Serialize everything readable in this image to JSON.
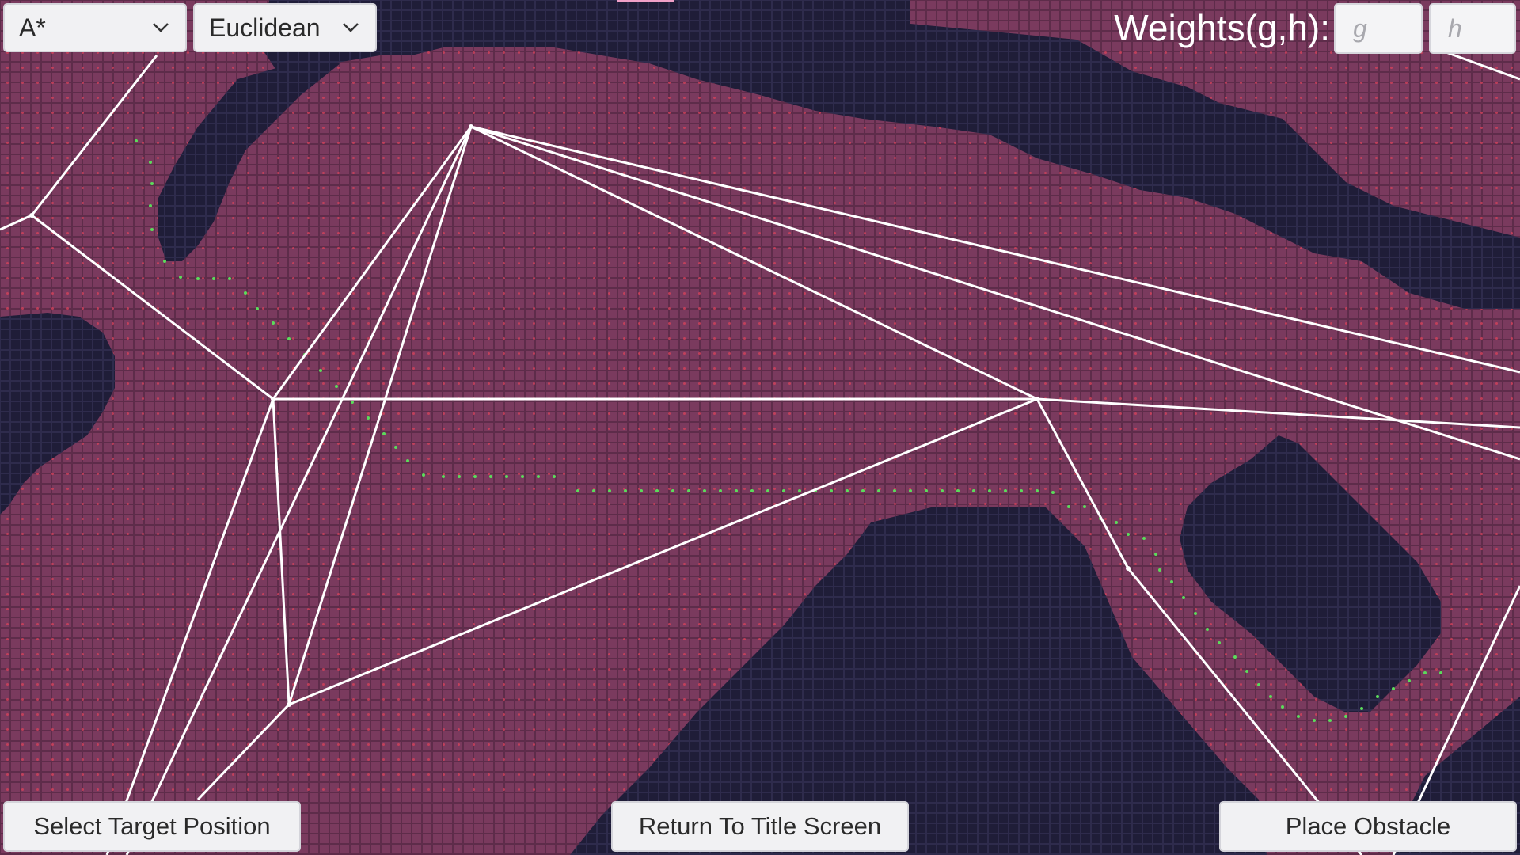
{
  "toolbar": {
    "algorithm": {
      "selected": "A*",
      "icon": "chevron-down-icon"
    },
    "heuristic": {
      "selected": "Euclidean",
      "icon": "chevron-down-icon"
    },
    "weights_label": "Weights(g,h):",
    "g_placeholder": "g",
    "h_placeholder": "h",
    "g_value": "",
    "h_value": ""
  },
  "buttons": {
    "select_target": "Select Target Position",
    "return_title": "Return To Title Screen",
    "place_obstacle": "Place Obstacle"
  },
  "colors": {
    "walkable_cell": "#7a3a5e",
    "obstacle_cell": "#1e1c36",
    "grid_line": "#5a2a48",
    "explored_dot": "#d9435a",
    "path_dot": "#5bdc5b",
    "graph_edge": "#ffffff",
    "ui_panel": "#f1f1f3"
  },
  "legend_icons": {
    "path": "path-dot-icon",
    "explored": "explored-dot-icon"
  }
}
